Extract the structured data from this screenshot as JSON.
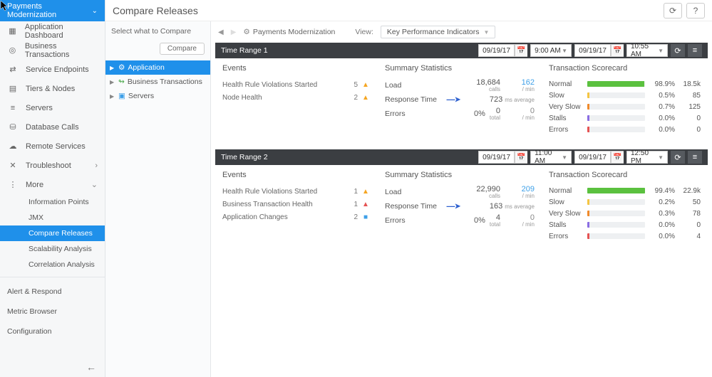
{
  "app_selector": {
    "name": "Payments Modernization"
  },
  "sidebar": {
    "items": [
      {
        "label": "Application Dashboard"
      },
      {
        "label": "Business Transactions"
      },
      {
        "label": "Service Endpoints"
      },
      {
        "label": "Tiers & Nodes"
      },
      {
        "label": "Servers"
      },
      {
        "label": "Database Calls"
      },
      {
        "label": "Remote Services"
      },
      {
        "label": "Troubleshoot"
      },
      {
        "label": "More"
      }
    ],
    "more_children": [
      {
        "label": "Information Points"
      },
      {
        "label": "JMX"
      },
      {
        "label": "Compare Releases"
      },
      {
        "label": "Scalability Analysis"
      },
      {
        "label": "Correlation Analysis"
      }
    ],
    "bottom": [
      {
        "label": "Alert & Respond"
      },
      {
        "label": "Metric Browser"
      },
      {
        "label": "Configuration"
      }
    ]
  },
  "page_title": "Compare Releases",
  "select_panel": {
    "heading": "Select what to Compare",
    "compare_btn": "Compare",
    "tree": [
      {
        "label": "Application"
      },
      {
        "label": "Business Transactions"
      },
      {
        "label": "Servers"
      }
    ]
  },
  "breadcrumb": {
    "path": "Payments Modernization"
  },
  "view": {
    "label": "View:",
    "value": "Key Performance Indicators"
  },
  "ranges": [
    {
      "title": "Time Range 1",
      "from_date": "09/19/17",
      "from_time": "9:00 AM",
      "to_date": "09/19/17",
      "to_time": "10:55 AM",
      "events": {
        "heading": "Events",
        "rows": [
          {
            "name": "Health Rule Violations Started",
            "count": "5",
            "icon": "warn"
          },
          {
            "name": "Node Health",
            "count": "2",
            "icon": "warn"
          }
        ]
      },
      "summary": {
        "heading": "Summary Statistics",
        "load": {
          "label": "Load",
          "v1": "18,684",
          "u1": "calls",
          "v2": "162",
          "u2": "/ min"
        },
        "rt": {
          "label": "Response Time",
          "v": "723",
          "u": "ms average",
          "arrow": true
        },
        "err": {
          "label": "Errors",
          "pct": "0%",
          "total": "0",
          "total_u": "total",
          "pm": "0",
          "pm_u": "/ min"
        }
      },
      "scorecard": {
        "heading": "Transaction Scorecard",
        "rows": [
          {
            "label": "Normal",
            "pct": "98.9%",
            "count": "18.5k",
            "color": "#5bc13f",
            "fill": 98.9
          },
          {
            "label": "Slow",
            "pct": "0.5%",
            "count": "85",
            "color": "#f5c542",
            "fill": 0.5
          },
          {
            "label": "Very Slow",
            "pct": "0.7%",
            "count": "125",
            "color": "#f08a2a",
            "fill": 0.7
          },
          {
            "label": "Stalls",
            "pct": "0.0%",
            "count": "0",
            "color": "#8a6de3",
            "fill": 0
          },
          {
            "label": "Errors",
            "pct": "0.0%",
            "count": "0",
            "color": "#e55353",
            "fill": 0
          }
        ]
      }
    },
    {
      "title": "Time Range 2",
      "from_date": "09/19/17",
      "from_time": "11:00 AM",
      "to_date": "09/19/17",
      "to_time": "12:50 PM",
      "events": {
        "heading": "Events",
        "rows": [
          {
            "name": "Health Rule Violations Started",
            "count": "1",
            "icon": "warn"
          },
          {
            "name": "Business Transaction Health",
            "count": "1",
            "icon": "crit"
          },
          {
            "name": "Application Changes",
            "count": "2",
            "icon": "info"
          }
        ]
      },
      "summary": {
        "heading": "Summary Statistics",
        "load": {
          "label": "Load",
          "v1": "22,990",
          "u1": "calls",
          "v2": "209",
          "u2": "/ min"
        },
        "rt": {
          "label": "Response Time",
          "v": "163",
          "u": "ms average",
          "arrow": true
        },
        "err": {
          "label": "Errors",
          "pct": "0%",
          "total": "4",
          "total_u": "total",
          "pm": "0",
          "pm_u": "/ min"
        }
      },
      "scorecard": {
        "heading": "Transaction Scorecard",
        "rows": [
          {
            "label": "Normal",
            "pct": "99.4%",
            "count": "22.9k",
            "color": "#5bc13f",
            "fill": 99.4
          },
          {
            "label": "Slow",
            "pct": "0.2%",
            "count": "50",
            "color": "#f5c542",
            "fill": 0.2
          },
          {
            "label": "Very Slow",
            "pct": "0.3%",
            "count": "78",
            "color": "#f08a2a",
            "fill": 0.3
          },
          {
            "label": "Stalls",
            "pct": "0.0%",
            "count": "0",
            "color": "#8a6de3",
            "fill": 0
          },
          {
            "label": "Errors",
            "pct": "0.0%",
            "count": "4",
            "color": "#e55353",
            "fill": 0
          }
        ]
      }
    }
  ]
}
